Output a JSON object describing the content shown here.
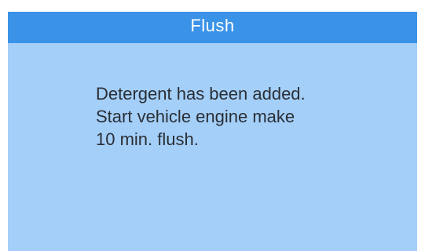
{
  "screen": {
    "title": "Flush",
    "message_lines": [
      "Detergent has been added.",
      "Start vehicle engine make",
      "10 min. flush."
    ]
  },
  "colors": {
    "title_bar": "#3a93e6",
    "screen_background": "#a4cff9",
    "title_text": "#ffffff",
    "message_text": "#2a2f36"
  }
}
